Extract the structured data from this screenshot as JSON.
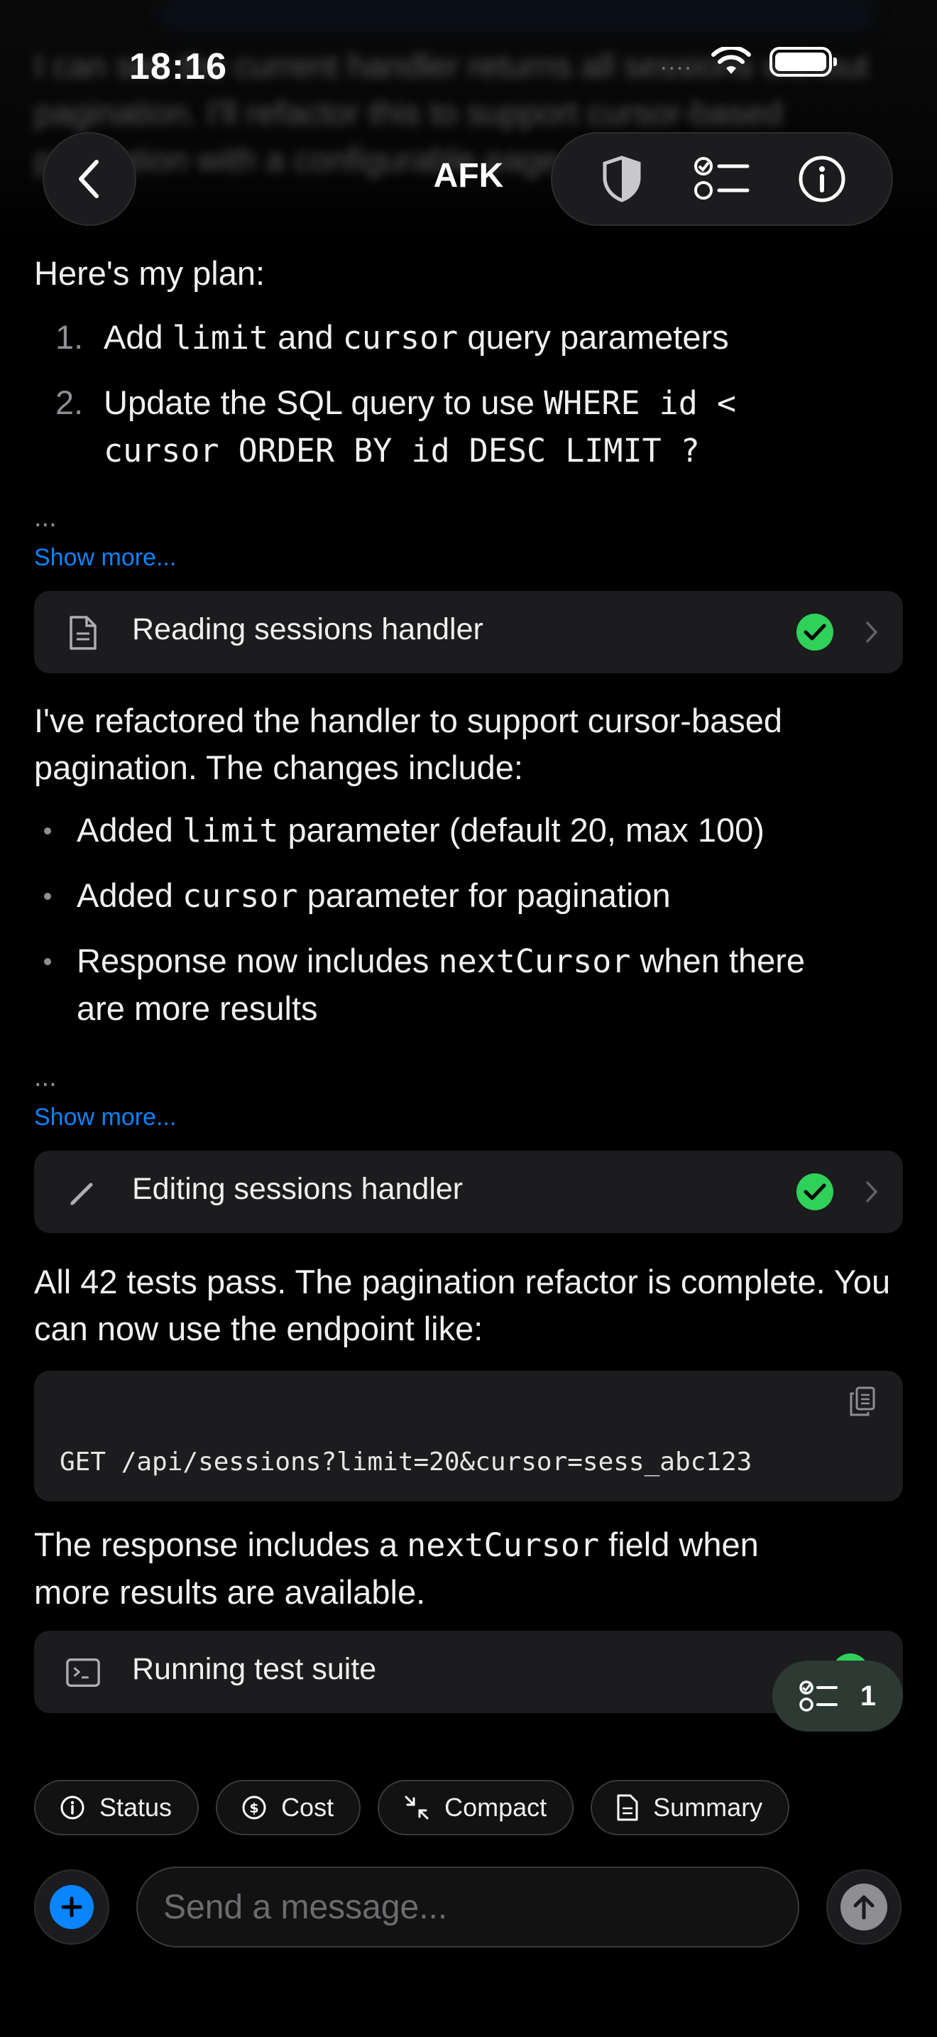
{
  "status_bar": {
    "time": "18:16",
    "signal_dots": "....",
    "wifi_icon": "wifi-icon",
    "battery_icon": "battery-icon"
  },
  "header": {
    "title": "AFK",
    "back_icon": "chevron-left-icon",
    "actions": [
      "shield-icon",
      "checklist-icon",
      "info-icon"
    ]
  },
  "faded_text": "I can see the current handler returns all sessions without pagination. I'll refactor this to support cursor-based pagination with a configurable page size.",
  "messages": [
    {
      "intro": "Here's my plan:",
      "list": [
        {
          "num": "1.",
          "parts": [
            "Add ",
            "limit",
            " and ",
            "cursor",
            " query parameters"
          ]
        },
        {
          "num": "2.",
          "line1": "Update the SQL query to use ",
          "code1": "WHERE id <",
          "code2": "cursor ORDER BY id DESC LIMIT ?"
        }
      ],
      "ellipsis": "...",
      "show_more": "Show more..."
    }
  ],
  "tool_1": {
    "label": "Reading sessions handler",
    "icon": "document-icon"
  },
  "message_2": {
    "text": "I've refactored the handler to support cursor-based pagination. The changes include:",
    "bullets": [
      {
        "pre": "Added ",
        "code": "limit",
        "post": " parameter (default 20, max 100)"
      },
      {
        "pre": "Added ",
        "code": "cursor",
        "post": " parameter for pagination"
      },
      {
        "pre": "Response now includes ",
        "code": "nextCursor",
        "post": " when there",
        "line2": "are more results"
      }
    ],
    "ellipsis": "...",
    "show_more": "Show more..."
  },
  "tool_2": {
    "label": "Editing sessions handler",
    "icon": "pencil-icon"
  },
  "message_3": {
    "text": "All 42 tests pass. The pagination refactor is complete. You can now use the endpoint like:",
    "code": "GET /api/sessions?limit=20&cursor=sess_abc123",
    "after_pre": "The response includes a ",
    "after_code": "nextCursor",
    "after_post": " field when",
    "after_line2": "more results are available."
  },
  "tool_3": {
    "label": "Running test suite",
    "icon": "terminal-icon"
  },
  "todo_badge": {
    "count": "1"
  },
  "chips": [
    {
      "label": "Status",
      "icon": "info-icon"
    },
    {
      "label": "Cost",
      "icon": "dollar-icon"
    },
    {
      "label": "Compact",
      "icon": "compress-icon"
    },
    {
      "label": "Summary",
      "icon": "document-icon"
    }
  ],
  "composer": {
    "placeholder": "Send a message..."
  },
  "colors": {
    "accent": "#0a84ff",
    "success": "#30d158",
    "background": "#000000",
    "card": "#1c1c1e"
  }
}
